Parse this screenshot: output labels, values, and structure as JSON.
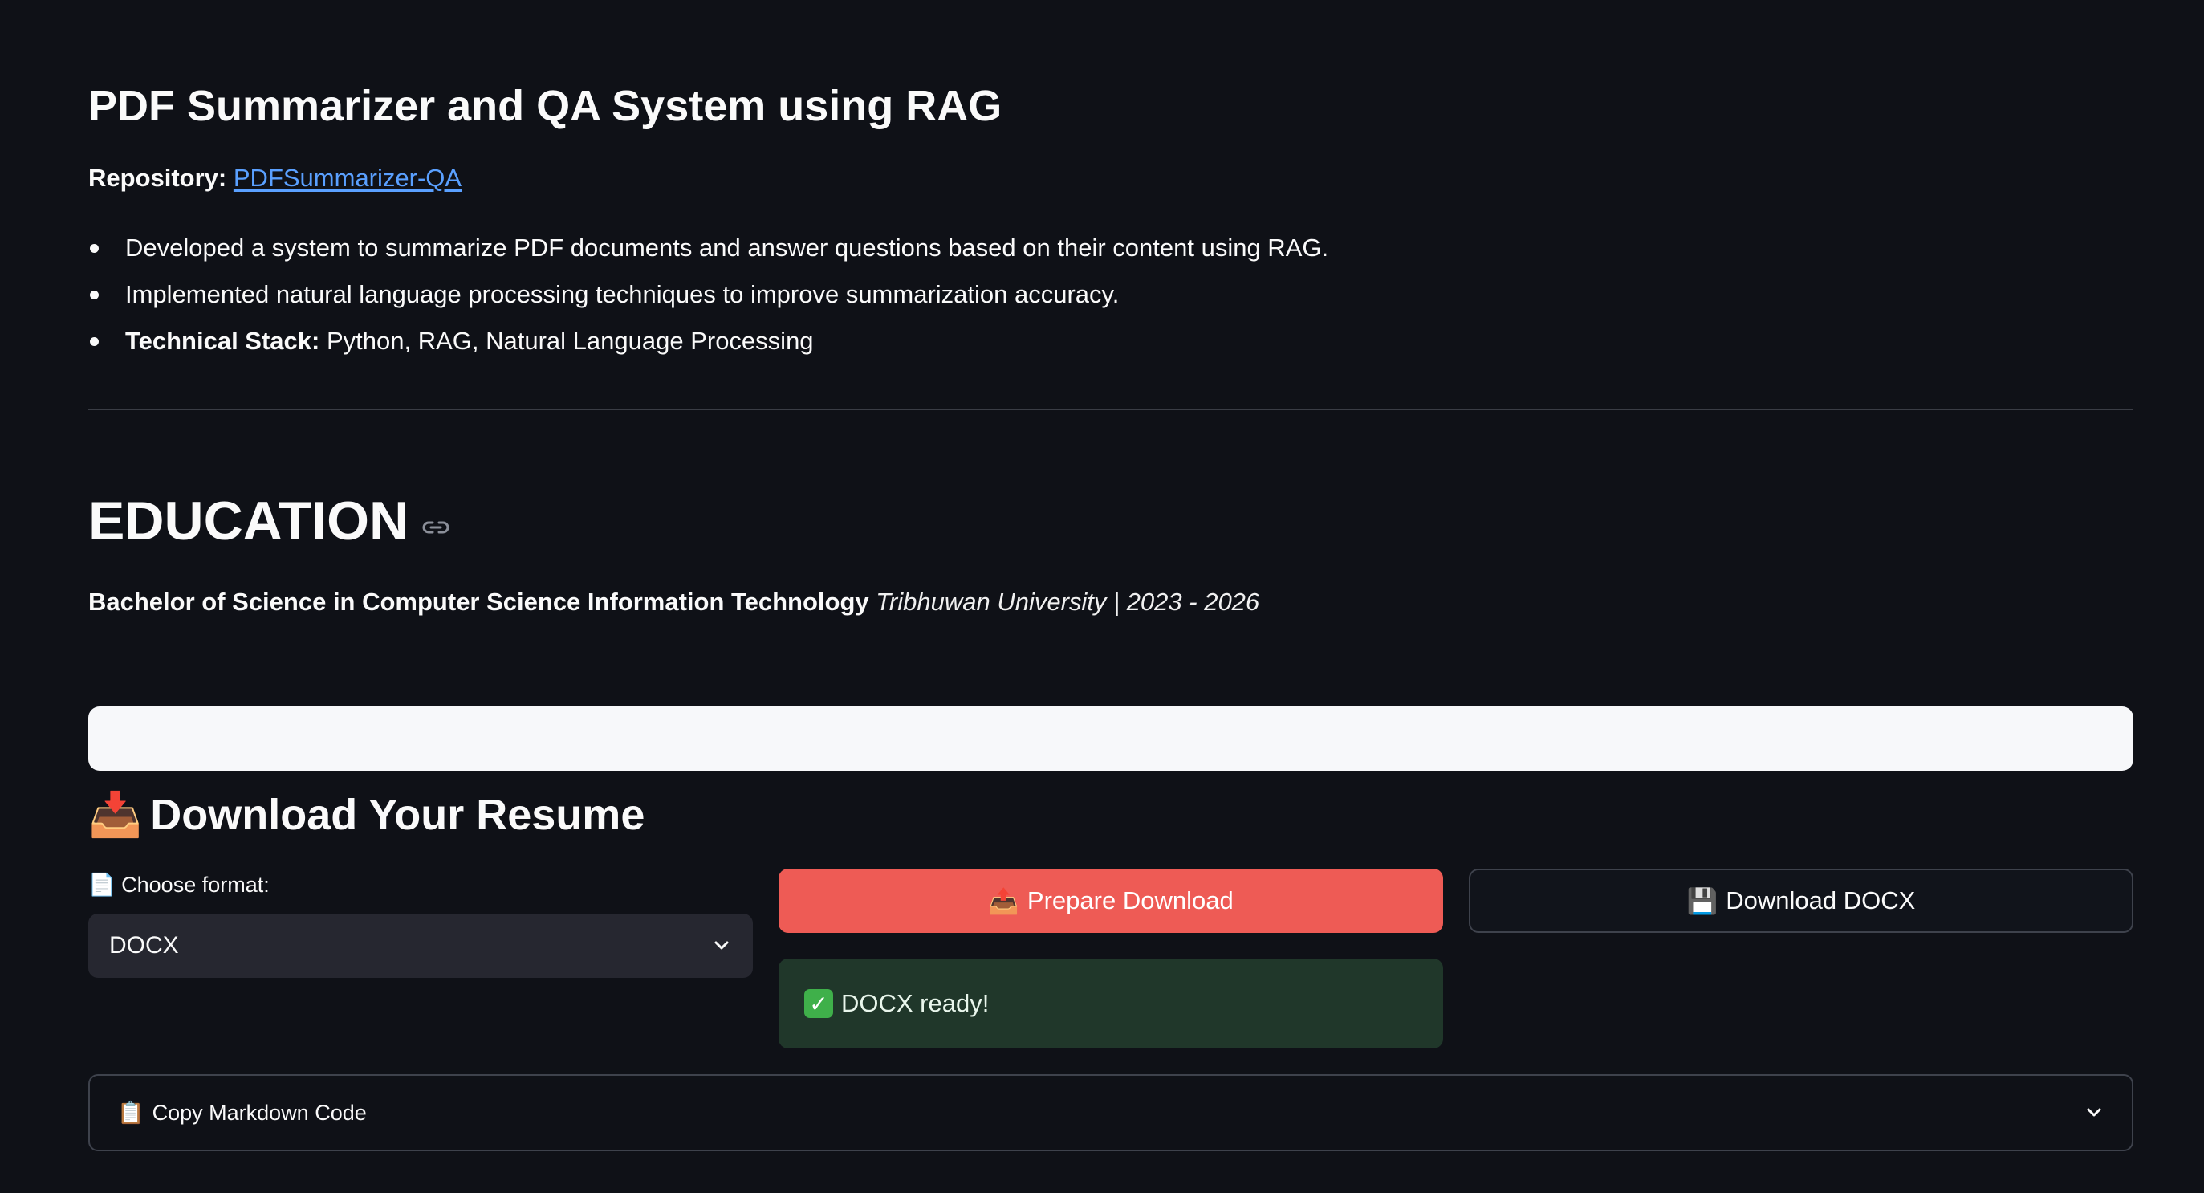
{
  "project": {
    "title": "PDF Summarizer and QA System using RAG",
    "repo_label": "Repository:",
    "repo_link_text": "PDFSummarizer-QA",
    "bullets": [
      {
        "bold": "",
        "text": "Developed a system to summarize PDF documents and answer questions based on their content using RAG."
      },
      {
        "bold": "",
        "text": "Implemented natural language processing techniques to improve summarization accuracy."
      },
      {
        "bold": "Technical Stack:",
        "text": " Python, RAG, Natural Language Processing"
      }
    ]
  },
  "education": {
    "heading": "EDUCATION",
    "degree": "Bachelor of Science in Computer Science Information Technology",
    "institution": "Tribhuwan University | 2023 - 2026"
  },
  "download": {
    "heading_icon": "📥",
    "heading": "Download Your Resume",
    "format_label_icon": "📄",
    "format_label": "Choose format:",
    "format_value": "DOCX",
    "prepare_icon": "📤",
    "prepare_label": "Prepare Download",
    "download_icon": "💾",
    "download_label": "Download DOCX",
    "status_icon": "✅",
    "status_text": "DOCX ready!"
  },
  "expander": {
    "icon": "📋",
    "label": "Copy Markdown Code"
  },
  "colors": {
    "background": "#0f1117",
    "primary_button": "#ee5b55",
    "link": "#5aa0ff",
    "success_bg": "#20372a"
  }
}
